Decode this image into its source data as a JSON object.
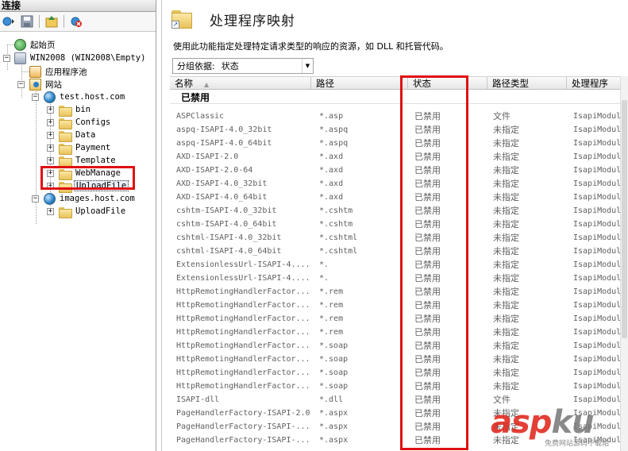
{
  "left_pane": {
    "header": "连接",
    "toolbar": [
      {
        "name": "connect-icon"
      },
      {
        "name": "save-icon"
      },
      {
        "name": "go-up-icon"
      },
      {
        "name": "disconnect-icon"
      }
    ],
    "tree": {
      "start_page": "起始页",
      "server": "WIN2008 (WIN2008\\Empty)",
      "app_pools": "应用程序池",
      "sites": "网站",
      "site1": "test.host.com",
      "site1_children": [
        "bin",
        "Configs",
        "Data",
        "Payment",
        "Template",
        "WebManage",
        "UploadFile"
      ],
      "site2": "images.host.com",
      "site2_children": [
        "UploadFile"
      ]
    }
  },
  "main": {
    "title": "处理程序映射",
    "description": "使用此功能指定处理特定请求类型的响应的资源，如 DLL 和托管代码。",
    "group_by_label": "分组依据:",
    "group_by_value": "状态",
    "columns": [
      "名称",
      "路径",
      "状态",
      "路径类型",
      "处理程序"
    ],
    "group_title": "已禁用",
    "rows": [
      [
        "ASPClassic",
        "*.asp",
        "已禁用",
        "文件",
        "IsapiModul"
      ],
      [
        "aspq-ISAPI-4.0_32bit",
        "*.aspq",
        "已禁用",
        "未指定",
        "IsapiModul"
      ],
      [
        "aspq-ISAPI-4.0_64bit",
        "*.aspq",
        "已禁用",
        "未指定",
        "IsapiModul"
      ],
      [
        "AXD-ISAPI-2.0",
        "*.axd",
        "已禁用",
        "未指定",
        "IsapiModul"
      ],
      [
        "AXD-ISAPI-2.0-64",
        "*.axd",
        "已禁用",
        "未指定",
        "IsapiModul"
      ],
      [
        "AXD-ISAPI-4.0_32bit",
        "*.axd",
        "已禁用",
        "未指定",
        "IsapiModul"
      ],
      [
        "AXD-ISAPI-4.0_64bit",
        "*.axd",
        "已禁用",
        "未指定",
        "IsapiModul"
      ],
      [
        "cshtm-ISAPI-4.0_32bit",
        "*.cshtm",
        "已禁用",
        "未指定",
        "IsapiModul"
      ],
      [
        "cshtm-ISAPI-4.0_64bit",
        "*.cshtm",
        "已禁用",
        "未指定",
        "IsapiModul"
      ],
      [
        "cshtml-ISAPI-4.0_32bit",
        "*.cshtml",
        "已禁用",
        "未指定",
        "IsapiModul"
      ],
      [
        "cshtml-ISAPI-4.0_64bit",
        "*.cshtml",
        "已禁用",
        "未指定",
        "IsapiModul"
      ],
      [
        "ExtensionlessUrl-ISAPI-4....",
        "*.",
        "已禁用",
        "未指定",
        "IsapiModul"
      ],
      [
        "ExtensionlessUrl-ISAPI-4....",
        "*.",
        "已禁用",
        "未指定",
        "IsapiModul"
      ],
      [
        "HttpRemotingHandlerFactor...",
        "*.rem",
        "已禁用",
        "未指定",
        "IsapiModul"
      ],
      [
        "HttpRemotingHandlerFactor...",
        "*.rem",
        "已禁用",
        "未指定",
        "IsapiModul"
      ],
      [
        "HttpRemotingHandlerFactor...",
        "*.rem",
        "已禁用",
        "未指定",
        "IsapiModul"
      ],
      [
        "HttpRemotingHandlerFactor...",
        "*.rem",
        "已禁用",
        "未指定",
        "IsapiModul"
      ],
      [
        "HttpRemotingHandlerFactor...",
        "*.soap",
        "已禁用",
        "未指定",
        "IsapiModul"
      ],
      [
        "HttpRemotingHandlerFactor...",
        "*.soap",
        "已禁用",
        "未指定",
        "IsapiModul"
      ],
      [
        "HttpRemotingHandlerFactor...",
        "*.soap",
        "已禁用",
        "未指定",
        "IsapiModul"
      ],
      [
        "HttpRemotingHandlerFactor...",
        "*.soap",
        "已禁用",
        "未指定",
        "IsapiModul"
      ],
      [
        "ISAPI-dll",
        "*.dll",
        "已禁用",
        "文件",
        "IsapiModul"
      ],
      [
        "PageHandlerFactory-ISAPI-2.0",
        "*.aspx",
        "已禁用",
        "未指定",
        "IsapiModul"
      ],
      [
        "PageHandlerFactory-ISAPI-...",
        "*.aspx",
        "已禁用",
        "未指定",
        "IsapiModul"
      ],
      [
        "PageHandlerFactory-ISAPI-...",
        "*.aspx",
        "已禁用",
        "未指定",
        "IsapiModul"
      ]
    ]
  },
  "watermark": {
    "brand_a": "asp",
    "brand_b": "ku",
    "sub": "免费网站源码下载站"
  },
  "colors": {
    "highlight_box": "#e01010",
    "row_text": "#606060",
    "watermark_red": "#e0261c"
  }
}
